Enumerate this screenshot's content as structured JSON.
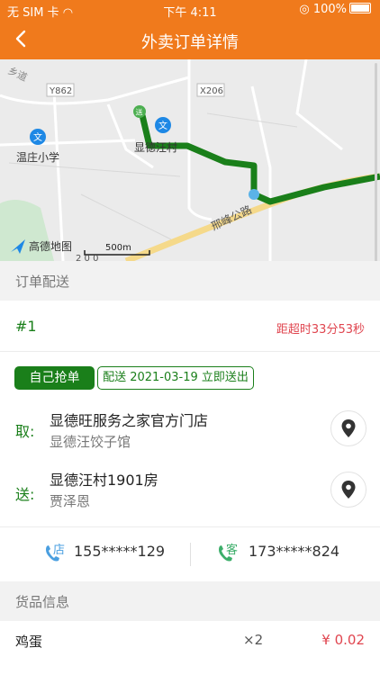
{
  "status_bar": {
    "carrier": "无 SIM 卡",
    "time": "下午 4:11",
    "battery": "100%"
  },
  "nav": {
    "title": "外卖订单详情"
  },
  "map": {
    "labels": {
      "road1": "Y862",
      "road2": "X206",
      "school": "温庄小学",
      "village": "显德汪村",
      "highway": "邢峰公路",
      "scale": "500m",
      "logo": "高德地图",
      "top_left": "乡道",
      "bottom_small": "2 0 0"
    },
    "start_marker": "送",
    "route_color": "#1a7f1a"
  },
  "delivery_section": {
    "header": "订单配送"
  },
  "order": {
    "number": "#1",
    "timeout": "距超时33分53秒"
  },
  "tags": {
    "self_grab": "自己抢单",
    "delivery_info": "配送 2021-03-19 立即送出"
  },
  "pickup": {
    "tag": "取:",
    "name": "显德旺服务之家官方门店",
    "sub": "显德汪饺子馆"
  },
  "dropoff": {
    "tag": "送:",
    "address": "显德汪村1901房",
    "person": "贾泽恩"
  },
  "contacts": {
    "store_char": "店",
    "store_phone": "155*****129",
    "customer_char": "客",
    "customer_phone": "173*****824"
  },
  "goods_section": {
    "header": "货品信息"
  },
  "goods": [
    {
      "name": "鸡蛋",
      "qty": "×2",
      "price": "¥ 0.02"
    }
  ]
}
